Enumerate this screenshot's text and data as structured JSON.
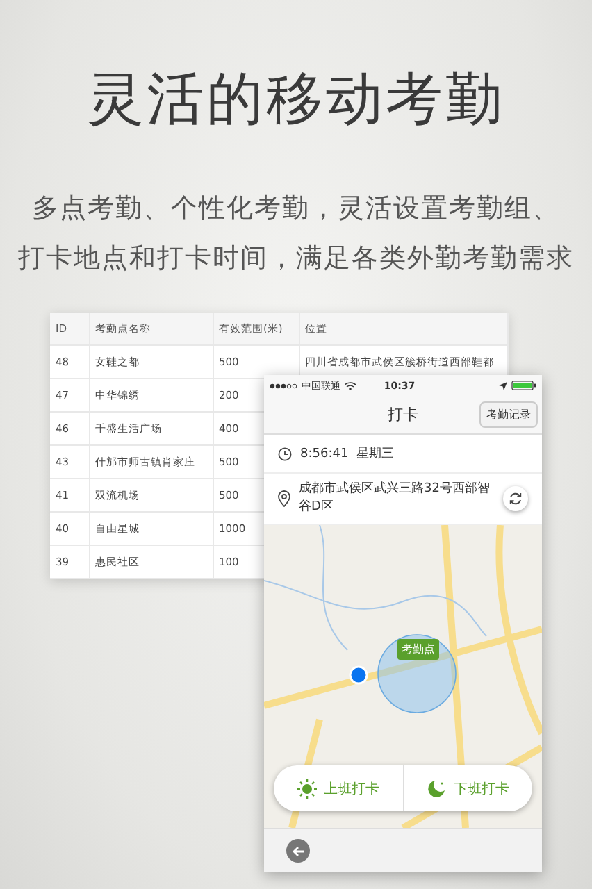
{
  "headline": "灵活的移动考勤",
  "tagline_lines": [
    "多点考勤、个性化考勤，灵活设置考勤组、",
    "打卡地点和打卡时间，满足各类外勤考勤需求"
  ],
  "table": {
    "columns": [
      "ID",
      "考勤点名称",
      "有效范围(米)",
      "位置"
    ],
    "rows": [
      [
        "48",
        "女鞋之都",
        "500",
        "四川省成都市武侯区簇桥街道西部鞋都"
      ],
      [
        "47",
        "中华锦绣",
        "200"
      ],
      [
        "46",
        "千盛生活广场",
        "400"
      ],
      [
        "43",
        "什邡市师古镇肖家庄",
        "500"
      ],
      [
        "41",
        "双流机场",
        "500"
      ],
      [
        "40",
        "自由星城",
        "1000"
      ],
      [
        "39",
        "惠民社区",
        "100"
      ]
    ]
  },
  "phone": {
    "status_bar": {
      "carrier": "中国联通",
      "time": "10:37"
    },
    "nav": {
      "title": "打卡",
      "action": "考勤记录"
    },
    "clock": {
      "time": "8:56:41",
      "weekday": "星期三"
    },
    "address": "成都市武侯区武兴三路32号西部智谷D区",
    "map": {
      "marker": "考勤点"
    },
    "buttons": [
      {
        "kind": "sun",
        "label": "上班打卡"
      },
      {
        "kind": "moon",
        "label": "下班打卡"
      }
    ]
  }
}
